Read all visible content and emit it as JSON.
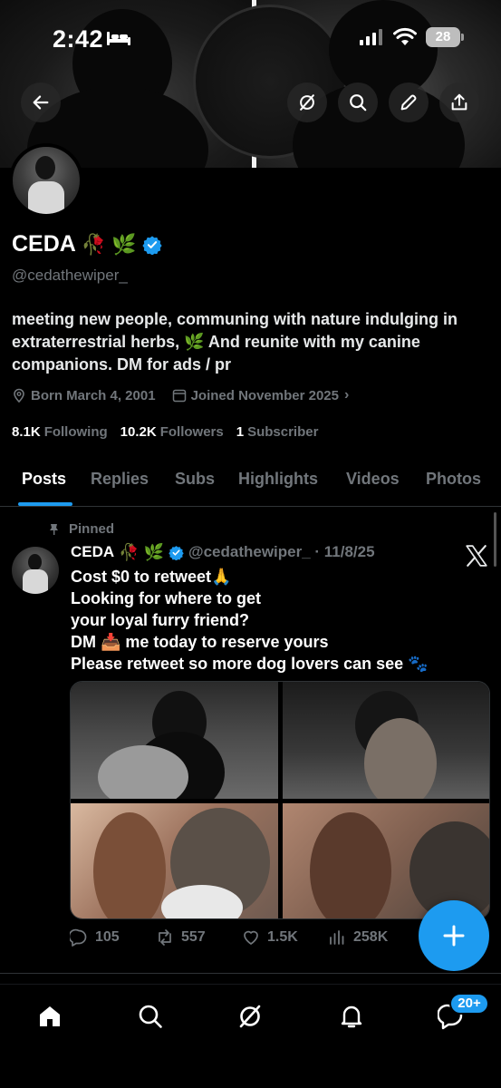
{
  "status_bar": {
    "time": "2:42",
    "battery": "28"
  },
  "profile": {
    "display_name": "CEDA",
    "name_emojis": "🥀 🌿",
    "handle": "@cedathewiper_",
    "bio": "meeting new people, communing with nature indulging in extraterrestrial herbs, 🌿  And reunite with my canine companions. DM for ads / pr",
    "born": "Born March 4, 2001",
    "joined": "Joined November 2025",
    "following_count": "8.1K",
    "following_label": "Following",
    "followers_count": "10.2K",
    "followers_label": "Followers",
    "subscribers_count": "1",
    "subscribers_label": "Subscriber"
  },
  "tabs": [
    {
      "label": "Posts",
      "active": true
    },
    {
      "label": "Replies"
    },
    {
      "label": "Subs"
    },
    {
      "label": "Highlights"
    },
    {
      "label": "Videos"
    },
    {
      "label": "Photos"
    }
  ],
  "tweet": {
    "pinned_label": "Pinned",
    "name": "CEDA",
    "name_emojis": "🥀 🌿",
    "handle_date": "@cedathewiper_ · 11/8/25",
    "text": "Cost $0 to retweet🙏\nLooking for where to get\nyour loyal furry friend?\nDM  📥 me today to reserve yours\nPlease retweet so more dog lovers can see 🐾",
    "replies": "105",
    "retweets": "557",
    "likes": "1.5K",
    "views": "258K"
  },
  "bottom_nav": {
    "messages_badge": "20+"
  },
  "colors": {
    "accent": "#1d9bf0",
    "muted": "#71767b",
    "background": "#000000"
  }
}
